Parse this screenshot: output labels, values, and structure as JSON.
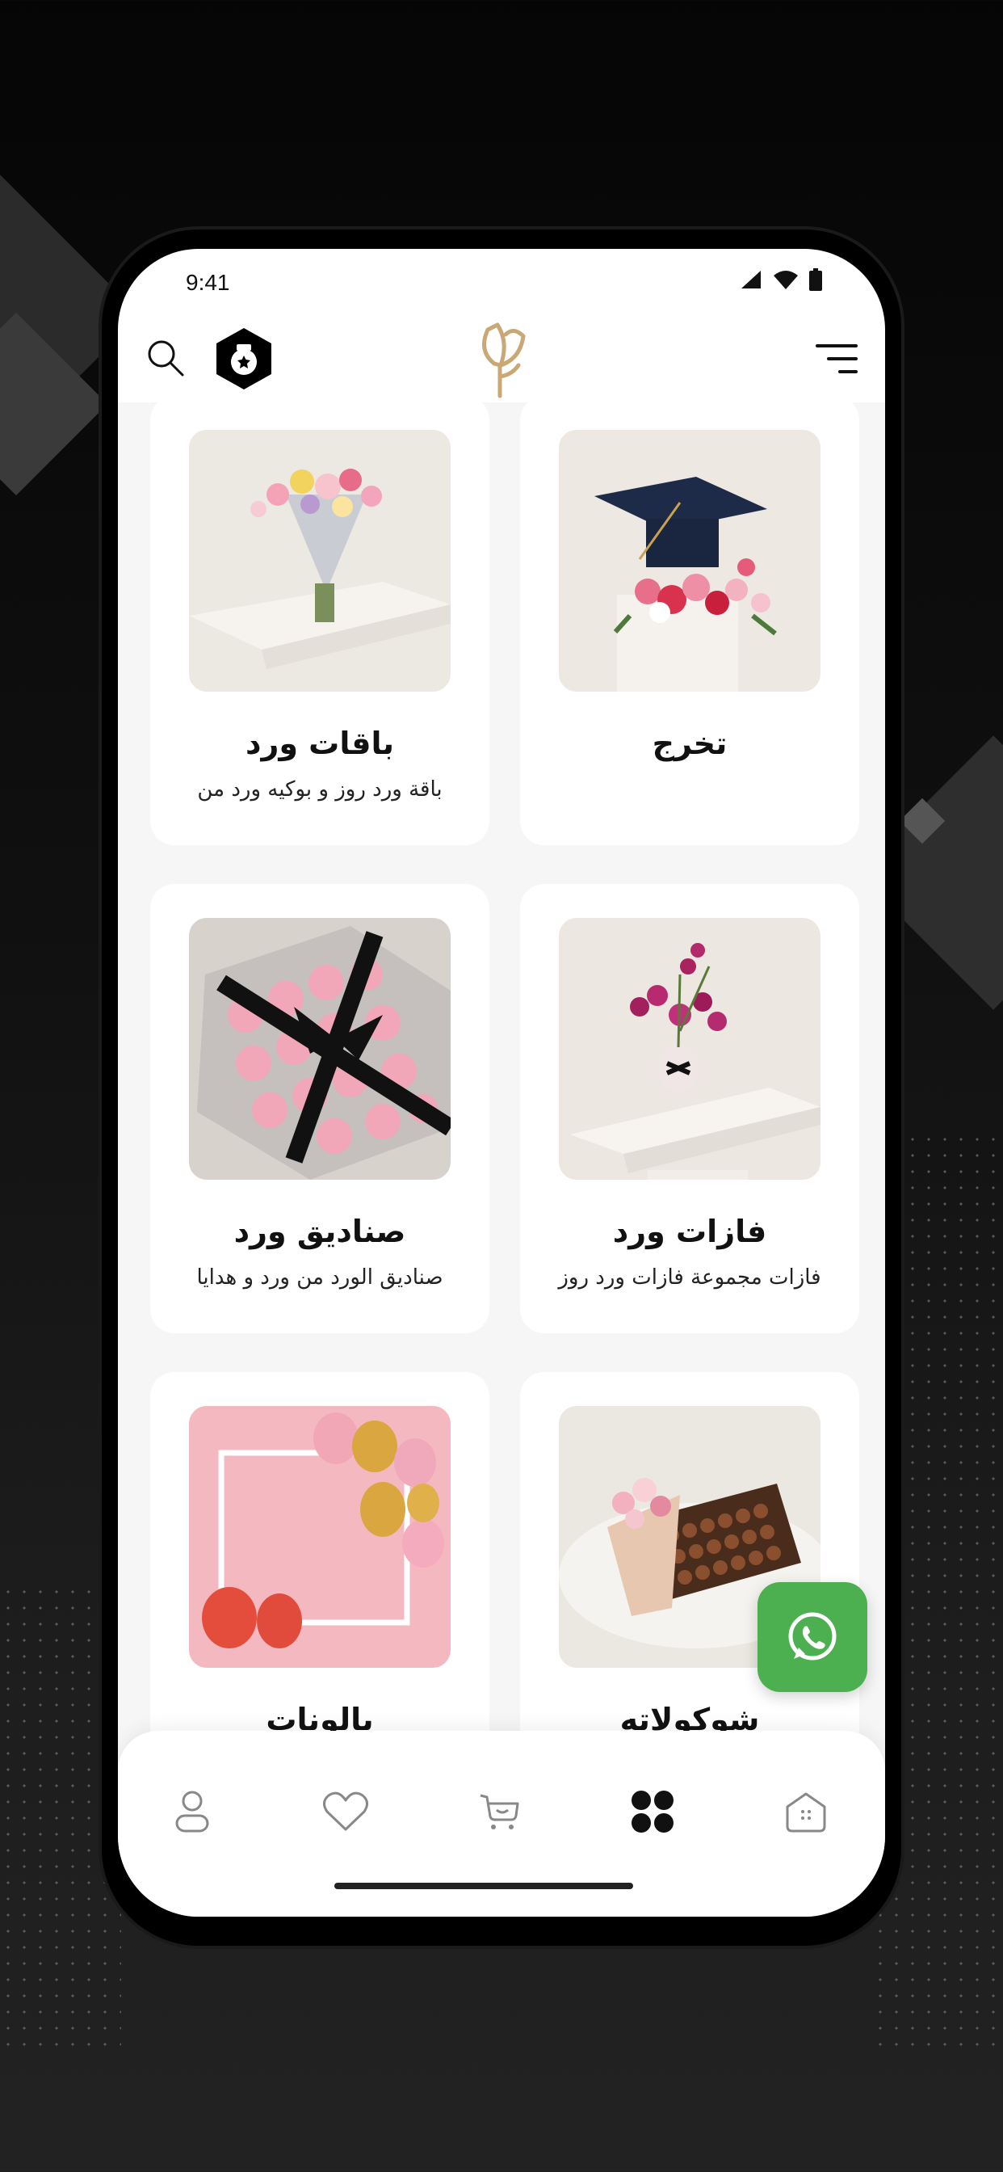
{
  "status_bar": {
    "time": "9:41"
  },
  "app": {
    "logo_icon": "flower-logo-icon",
    "accent_color": "#c9a876",
    "badge_color": "#000000"
  },
  "categories": [
    {
      "title": "تخرج",
      "description": ""
    },
    {
      "title": "باقات ورد",
      "description": "باقة ورد روز و بوكيه ورد من"
    },
    {
      "title": "فازات ورد",
      "description": "فازات مجموعة فازات ورد روز"
    },
    {
      "title": "صناديق ورد",
      "description": "صناديق الورد من ورد و هدايا"
    },
    {
      "title": "شوكولاته",
      "description": ""
    },
    {
      "title": "بالونات",
      "description": ""
    }
  ],
  "whatsapp": {
    "icon": "whatsapp-icon",
    "color": "#4caf50"
  },
  "bottom_nav": [
    "profile-icon",
    "heart-icon",
    "cart-icon",
    "categories-icon",
    "home-icon"
  ]
}
